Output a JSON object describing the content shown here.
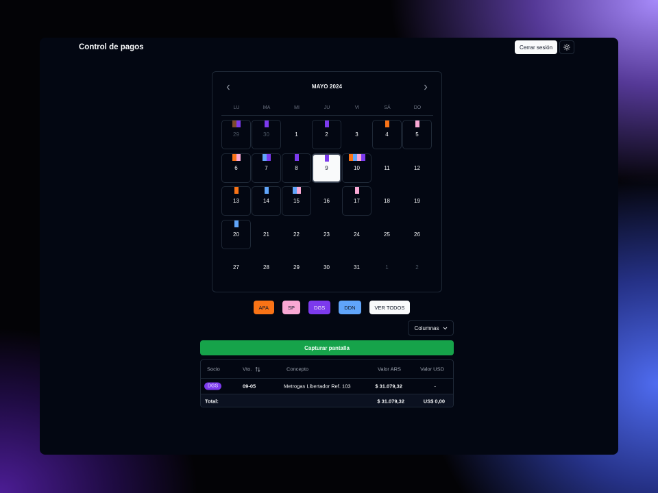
{
  "app": {
    "title": "Control de pagos",
    "logout_label": "Cerrar sesión",
    "theme_icon": "sun-icon"
  },
  "colors": {
    "APA": "#f97316",
    "SP": "#f9a8d4",
    "DGS": "#7c3aed",
    "DDN": "#60a5fa",
    "dark_brown": "#7c4a2d"
  },
  "calendar": {
    "month_label": "MAYO 2024",
    "prev_icon": "chevron-left-icon",
    "next_icon": "chevron-right-icon",
    "weekdays": [
      "LU",
      "MA",
      "MI",
      "JU",
      "VI",
      "SÁ",
      "DO"
    ],
    "weeks": [
      [
        {
          "d": "29",
          "outside": true,
          "bordered": true,
          "tags": [
            "dark_brown",
            "DGS"
          ]
        },
        {
          "d": "30",
          "outside": true,
          "bordered": true,
          "tags": [
            "DGS"
          ]
        },
        {
          "d": "1",
          "tags": []
        },
        {
          "d": "2",
          "bordered": true,
          "tags": [
            "DGS"
          ]
        },
        {
          "d": "3",
          "tags": []
        },
        {
          "d": "4",
          "bordered": true,
          "tags": [
            "APA"
          ]
        },
        {
          "d": "5",
          "bordered": true,
          "tags": [
            "SP"
          ]
        }
      ],
      [
        {
          "d": "6",
          "bordered": true,
          "tags": [
            "APA",
            "SP"
          ]
        },
        {
          "d": "7",
          "bordered": true,
          "tags": [
            "DDN",
            "DGS"
          ]
        },
        {
          "d": "8",
          "bordered": true,
          "tags": [
            "DGS"
          ]
        },
        {
          "d": "9",
          "today": true,
          "tags": [
            "DGS"
          ]
        },
        {
          "d": "10",
          "bordered": true,
          "tags": [
            "APA",
            "DDN",
            "SP",
            "DGS"
          ]
        },
        {
          "d": "11",
          "tags": []
        },
        {
          "d": "12",
          "tags": []
        }
      ],
      [
        {
          "d": "13",
          "bordered": true,
          "tags": [
            "APA"
          ]
        },
        {
          "d": "14",
          "bordered": true,
          "tags": [
            "DDN"
          ]
        },
        {
          "d": "15",
          "bordered": true,
          "tags": [
            "DDN",
            "SP"
          ]
        },
        {
          "d": "16",
          "tags": []
        },
        {
          "d": "17",
          "bordered": true,
          "tags": [
            "SP"
          ]
        },
        {
          "d": "18",
          "tags": []
        },
        {
          "d": "19",
          "tags": []
        }
      ],
      [
        {
          "d": "20",
          "bordered": true,
          "tags": [
            "DDN"
          ]
        },
        {
          "d": "21",
          "tags": []
        },
        {
          "d": "22",
          "tags": []
        },
        {
          "d": "23",
          "tags": []
        },
        {
          "d": "24",
          "tags": []
        },
        {
          "d": "25",
          "tags": []
        },
        {
          "d": "26",
          "tags": []
        }
      ],
      [
        {
          "d": "27",
          "tags": []
        },
        {
          "d": "28",
          "tags": []
        },
        {
          "d": "29",
          "tags": []
        },
        {
          "d": "30",
          "tags": []
        },
        {
          "d": "31",
          "tags": []
        },
        {
          "d": "1",
          "outside": true,
          "tags": []
        },
        {
          "d": "2",
          "outside": true,
          "tags": []
        }
      ]
    ]
  },
  "legend": [
    {
      "label": "APA",
      "bg": "#f97316",
      "fg": "#111827"
    },
    {
      "label": "SP",
      "bg": "#f9a8d4",
      "fg": "#111827"
    },
    {
      "label": "DGS",
      "bg": "#7c3aed",
      "fg": "#f3f4f6"
    },
    {
      "label": "DDN",
      "bg": "#60a5fa",
      "fg": "#111827"
    },
    {
      "label": "VER TODOS",
      "bg": "#f9fafb",
      "fg": "#111827"
    }
  ],
  "columns_label": "Columnas",
  "columns_icon": "chevron-down-icon",
  "capture_label": "Capturar pantalla",
  "table": {
    "headers": {
      "socio": "Socio",
      "vto": "Vto.",
      "concepto": "Concepto",
      "valor_ars": "Valor ARS",
      "valor_usd": "Valor USD"
    },
    "sort_icon": "sort-icon",
    "row": {
      "socio": "DGS",
      "vto": "09-05",
      "concepto": "Metrogas Libertador Ref. 103",
      "valor_ars": "$ 31.079,32",
      "valor_usd": "-"
    },
    "footer": {
      "label": "Total:",
      "valor_ars": "$ 31.079,32",
      "valor_usd": "US$ 0,00"
    }
  }
}
